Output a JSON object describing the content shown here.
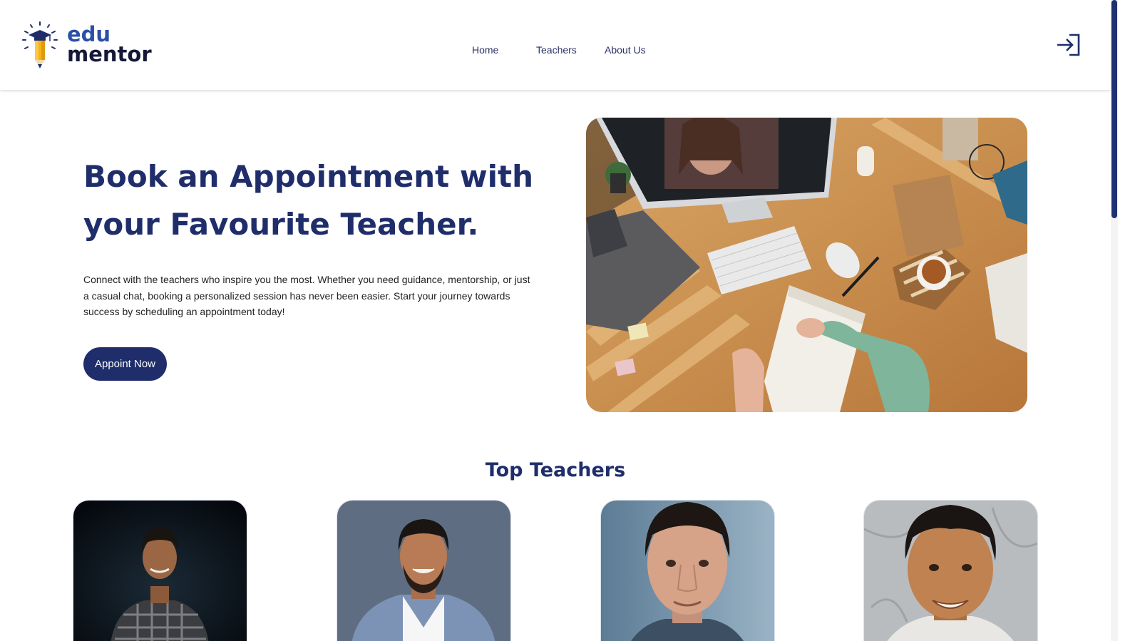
{
  "brand": {
    "logo_line1": "edu",
    "logo_line2": "mentor",
    "primary_color": "#1f2e6b",
    "accent_color": "#2b4fa6"
  },
  "nav": {
    "items": [
      {
        "label": "Home"
      },
      {
        "label": "Teachers"
      },
      {
        "label": "About Us"
      }
    ],
    "login_icon": "login-icon"
  },
  "hero": {
    "title_line1": "Book an Appointment with",
    "title_line2": "your Favourite Teacher.",
    "description": "Connect with the teachers who inspire you the most. Whether you need guidance, mentorship, or just a casual chat, booking a personalized session has never been easier. Start your journey towards success by scheduling an appointment today!",
    "cta_label": "Appoint Now"
  },
  "top_teachers": {
    "title": "Top Teachers",
    "cards": [
      {
        "photo": "teacher-photo-1"
      },
      {
        "photo": "teacher-photo-2"
      },
      {
        "photo": "teacher-photo-3"
      },
      {
        "photo": "teacher-photo-4"
      }
    ]
  }
}
